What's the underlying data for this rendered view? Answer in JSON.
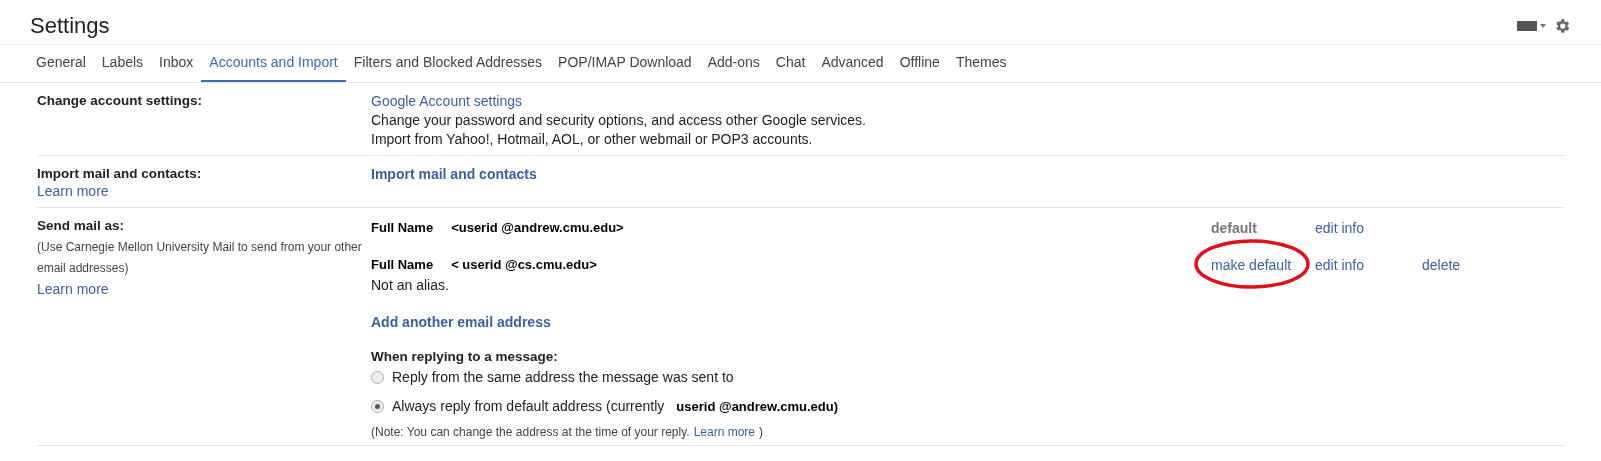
{
  "title": "Settings",
  "tabs": [
    {
      "label": "General",
      "selected": false
    },
    {
      "label": "Labels",
      "selected": false
    },
    {
      "label": "Inbox",
      "selected": false
    },
    {
      "label": "Accounts and Import",
      "selected": true
    },
    {
      "label": "Filters and Blocked Addresses",
      "selected": false
    },
    {
      "label": "POP/IMAP Download",
      "selected": false
    },
    {
      "label": "Add-ons",
      "selected": false
    },
    {
      "label": "Chat",
      "selected": false
    },
    {
      "label": "Advanced",
      "selected": false
    },
    {
      "label": "Offline",
      "selected": false
    },
    {
      "label": "Themes",
      "selected": false
    }
  ],
  "change_account": {
    "label": "Change account settings:",
    "link": "Google Account settings",
    "lines": [
      "Change your password and security options, and access other Google services.",
      "Import from Yahoo!, Hotmail, AOL, or other webmail or POP3 accounts."
    ]
  },
  "import": {
    "label": "Import mail and contacts:",
    "learn_more": "Learn more",
    "action": "Import mail and contacts"
  },
  "send_mail": {
    "label": "Send mail as:",
    "note": "(Use Carnegie Mellon University Mail to send from your other email addresses)",
    "learn_more": "Learn more",
    "accounts": [
      {
        "name": "Full  Name",
        "address": "<userid @andrew.cmu.edu>",
        "default": true,
        "status": "default",
        "circled": false,
        "actions": [
          "edit info"
        ]
      },
      {
        "name": "Full Name",
        "address": "< userid @cs.cmu.edu>",
        "default": false,
        "status": "make default",
        "circled": true,
        "actions": [
          "edit info",
          "delete"
        ],
        "sub": "Not an alias."
      }
    ],
    "add": "Add another email address",
    "reply_heading": "When replying to a message:",
    "reply_options": [
      {
        "label": "Reply from the same address the message was sent to",
        "selected": false
      },
      {
        "label": "Always reply from default address (currently",
        "address": "userid @andrew.cmu.edu)",
        "selected": true
      }
    ],
    "reply_note": "(Note: You can change the address at the time of your reply.",
    "reply_note_link": "Learn more",
    "reply_note_end": ")"
  }
}
